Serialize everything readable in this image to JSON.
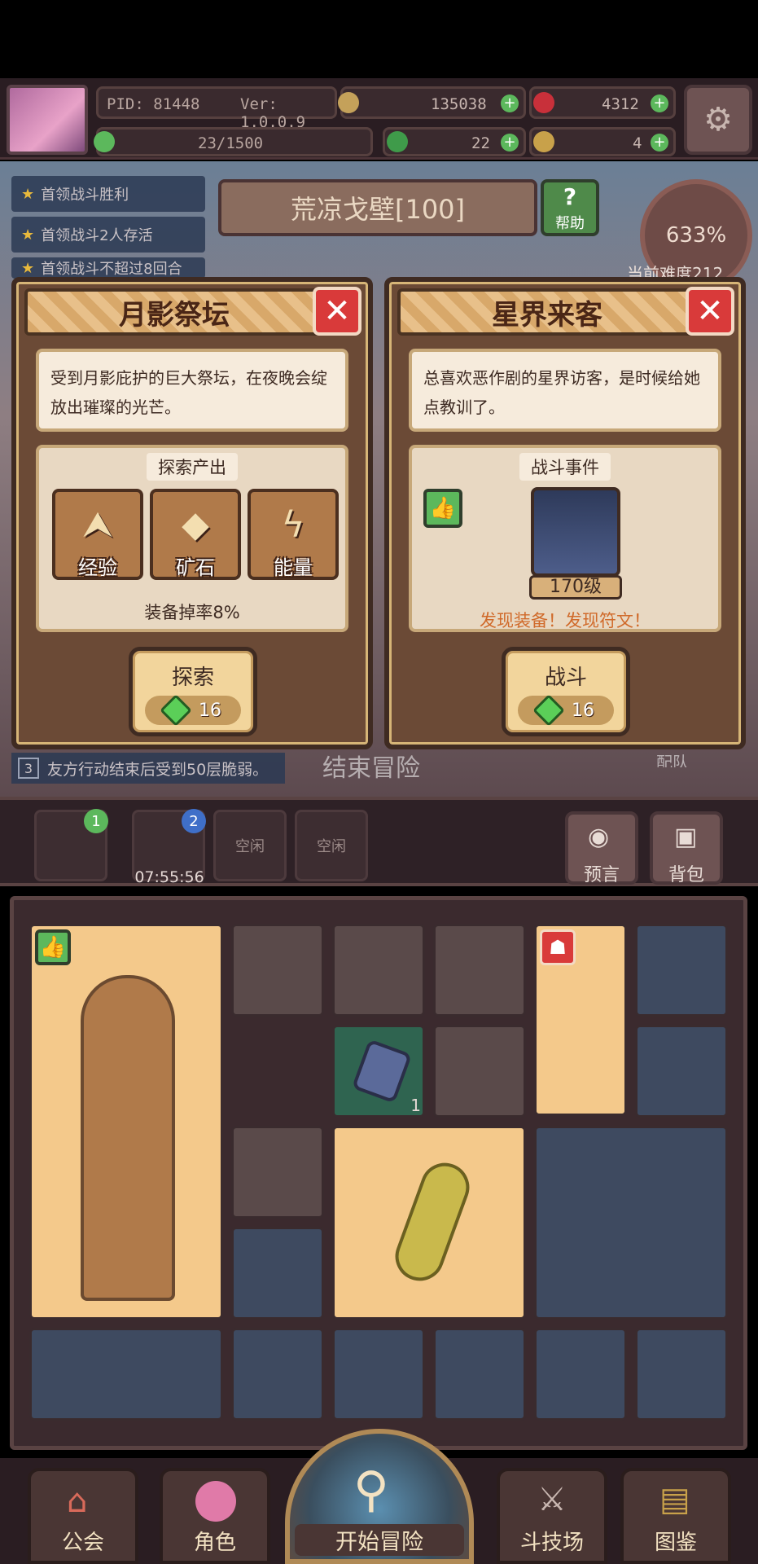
{
  "header": {
    "pid": "PID: 81448",
    "version": "Ver: 1.0.0.9",
    "gold": "135038",
    "rubies": "4312",
    "energy": "23/1500",
    "clover": "22",
    "keys": "4"
  },
  "quests": [
    "首领战斗胜利",
    "首领战斗2人存活",
    "首领战斗不超过8回合"
  ],
  "region": {
    "name": "荒凉戈壁[100]",
    "help_label": "帮助"
  },
  "difficulty": {
    "percent": "633%",
    "label": "当前难度212"
  },
  "left_card": {
    "title": "月影祭坛",
    "description": "受到月影庇护的巨大祭坛，在夜晚会绽放出璀璨的光芒。",
    "section_title": "探索产出",
    "outputs": [
      {
        "label": "经验",
        "icon": "chevron-up-icon"
      },
      {
        "label": "矿石",
        "icon": "ore-icon"
      },
      {
        "label": "能量",
        "icon": "lightning-icon"
      }
    ],
    "drop_rate": "装备掉率8%",
    "action_label": "探索",
    "cost": "16"
  },
  "right_card": {
    "title": "星界来客",
    "description": "总喜欢恶作剧的星界访客，是时候给她点教训了。",
    "section_title": "战斗事件",
    "enemy_level": "170级",
    "findings": "发现装备！发现符文！",
    "action_label": "战斗",
    "cost": "16"
  },
  "log_line": {
    "index": "3",
    "text": "友方行动结束后受到50层脆弱。"
  },
  "end_adventure": "结束冒险",
  "team_label": "配队",
  "team_slots": [
    {
      "badge": "1",
      "timer": ""
    },
    {
      "badge": "2",
      "timer": "07:55:56"
    },
    {
      "label": "空闲"
    },
    {
      "label": "空闲"
    }
  ],
  "side_buttons": {
    "prophecy": "预言",
    "backpack": "背包"
  },
  "board": {
    "crystal_count": "1"
  },
  "nav": {
    "guild": "公会",
    "character": "角色",
    "start": "开始冒险",
    "arena": "斗技场",
    "codex": "图鉴"
  },
  "colors": {
    "accent_green": "#5cb85c",
    "close_red": "#d93a3a",
    "find_orange": "#d06a2a"
  }
}
